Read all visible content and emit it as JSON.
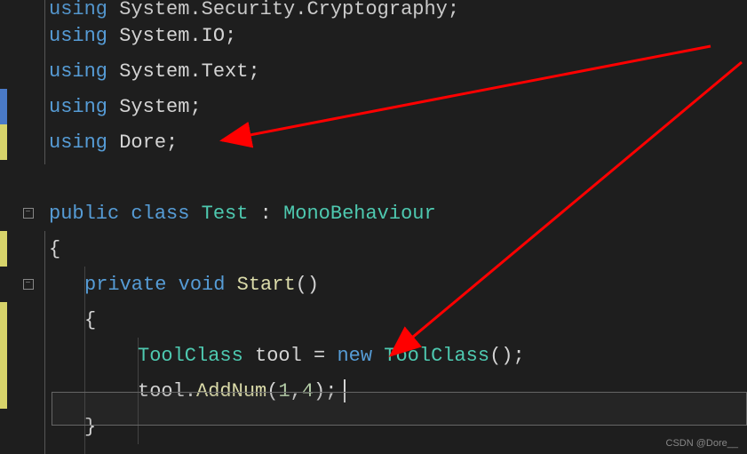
{
  "watermark": "CSDN @Dore__",
  "lines": {
    "l0": {
      "using": "using",
      "ns": "System.Security.Cryptography"
    },
    "l1": {
      "using": "using",
      "ns": "System.IO"
    },
    "l2": {
      "using": "using",
      "ns": "System.Text"
    },
    "l3": {
      "using": "using",
      "ns": "System"
    },
    "l4": {
      "using": "using",
      "ns": "Dore"
    },
    "class_decl": {
      "public": "public",
      "class": "class",
      "name": "Test",
      "colon": ":",
      "base": "MonoBehaviour"
    },
    "brace_open": "{",
    "method_decl": {
      "private": "private",
      "void": "void",
      "name": "Start",
      "parens": "()"
    },
    "method_open": "{",
    "stmt1": {
      "type": "ToolClass",
      "var": "tool",
      "eq": "=",
      "new": "new",
      "ctor": "ToolClass",
      "parens": "();"
    },
    "stmt2": {
      "obj": "tool",
      "dot": ".",
      "method": "AddNum",
      "args": "(",
      "n1": "1",
      "comma": ",",
      "n2": "4",
      "close": ");"
    },
    "method_close": "}"
  }
}
